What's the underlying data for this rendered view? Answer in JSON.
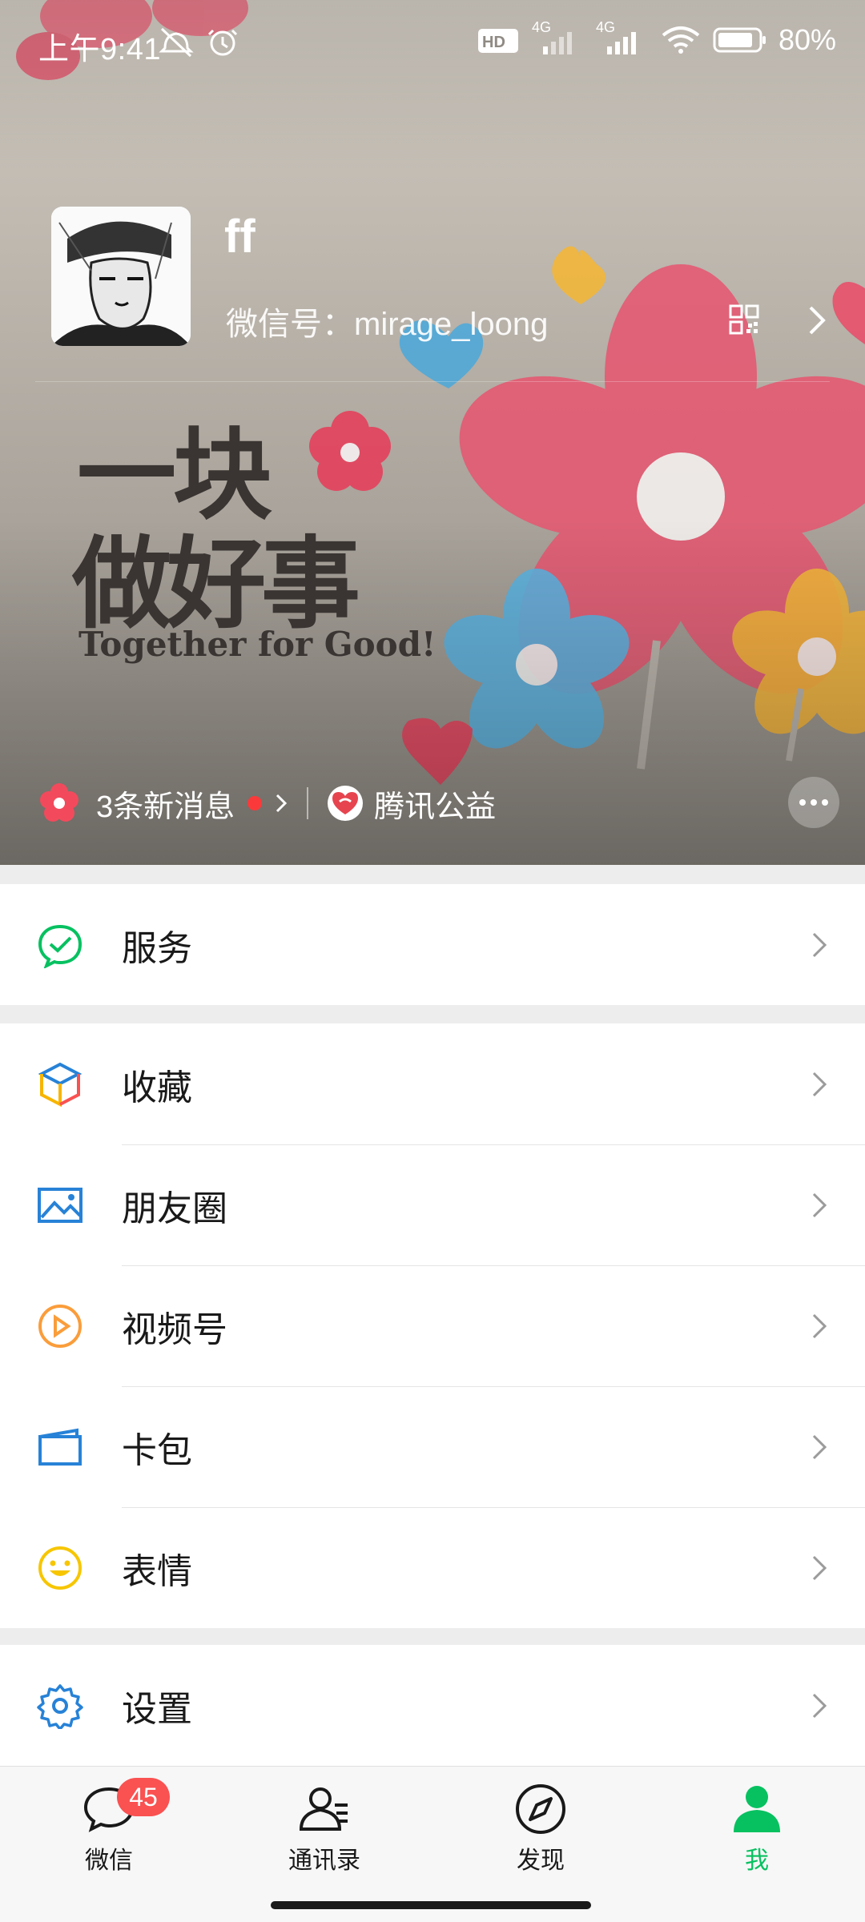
{
  "status_bar": {
    "time": "上午9:41",
    "network_1": "4G",
    "network_2": "4G",
    "battery": "80%",
    "icons": [
      "mute-icon",
      "alarm-icon",
      "hd-icon",
      "signal-icon",
      "wifi-icon",
      "battery-icon"
    ]
  },
  "profile": {
    "name": "ff",
    "wechat_id": "微信号：mirage_loong",
    "icons": [
      "qr-code-icon",
      "chevron-right-icon"
    ]
  },
  "hero": {
    "banner_title_line1": "一块",
    "banner_title_line2": "做好事",
    "banner_subtitle": "Together for Good!",
    "new_messages": "3条新消息",
    "charity_label": "腾讯公益"
  },
  "menu": {
    "group1": [
      {
        "label": "服务",
        "icon": "service-icon",
        "color": "#07c160"
      }
    ],
    "group2": [
      {
        "label": "收藏",
        "icon": "favorites-cube-icon",
        "color": "#f7b500"
      },
      {
        "label": "朋友圈",
        "icon": "moments-picture-icon",
        "color": "#2782d7"
      },
      {
        "label": "视频号",
        "icon": "channels-play-icon",
        "color": "#fa9d3b"
      },
      {
        "label": "卡包",
        "icon": "card-wallet-icon",
        "color": "#2782d7"
      },
      {
        "label": "表情",
        "icon": "sticker-smile-icon",
        "color": "#f7c600"
      }
    ],
    "group3": [
      {
        "label": "设置",
        "icon": "settings-gear-icon",
        "color": "#2782d7"
      }
    ]
  },
  "tabbar": {
    "tabs": [
      {
        "label": "微信",
        "icon": "chat-bubble-icon",
        "badge": "45"
      },
      {
        "label": "通讯录",
        "icon": "contacts-icon"
      },
      {
        "label": "发现",
        "icon": "compass-icon"
      },
      {
        "label": "我",
        "icon": "me-person-icon",
        "active": true
      }
    ],
    "active_color": "#07c160"
  }
}
